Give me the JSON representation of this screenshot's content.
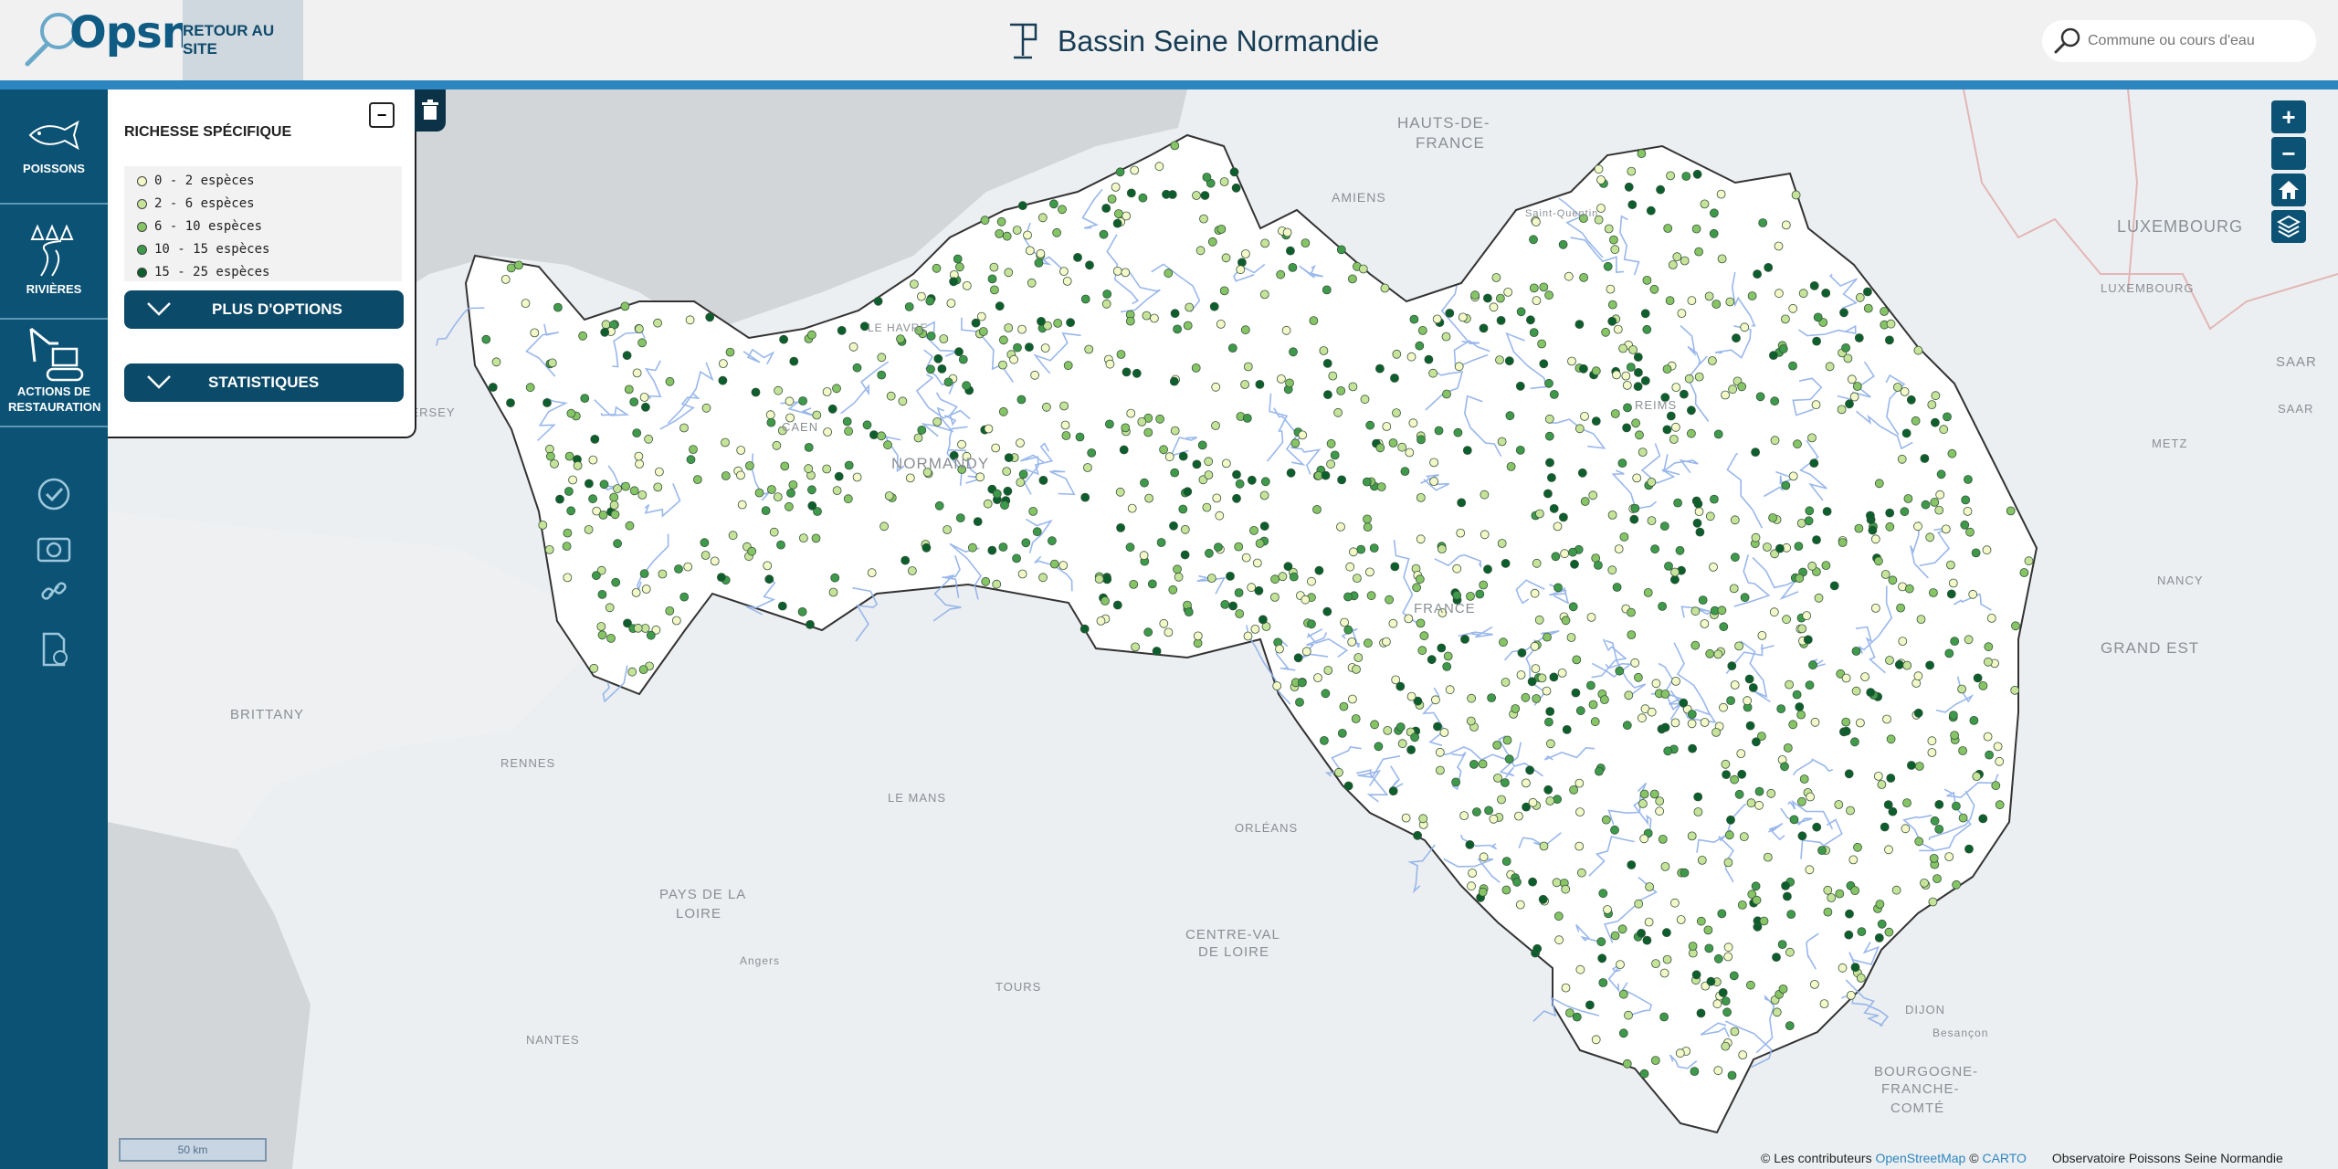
{
  "header": {
    "logo_text": "Opsn",
    "back_label": "RETOUR AU SITE",
    "title": "Bassin Seine Normandie",
    "search_placeholder": "Commune ou cours d'eau"
  },
  "sidebar": {
    "items": [
      {
        "label": "POISSONS"
      },
      {
        "label": "RIVIÈRES"
      },
      {
        "label": "ACTIONS DE RESTAURATION"
      }
    ]
  },
  "legend": {
    "title": "RICHESSE SPÉCIFIQUE",
    "classes": [
      {
        "label": "0 - 2 espèces",
        "color": "#f4f7c8"
      },
      {
        "label": "2 - 6 espèces",
        "color": "#c7e39a"
      },
      {
        "label": "6 - 10 espèces",
        "color": "#87c466"
      },
      {
        "label": "10 - 15 espèces",
        "color": "#3e9a4a"
      },
      {
        "label": "15 - 25 espèces",
        "color": "#0c5e2c"
      }
    ],
    "more_options_label": "PLUS D'OPTIONS",
    "statistics_label": "STATISTIQUES"
  },
  "map": {
    "labels": [
      {
        "text": "HAUTS-DE-"
      },
      {
        "text": "FRANCE"
      },
      {
        "text": "AMIENS"
      },
      {
        "text": "Saint-Quentin"
      },
      {
        "text": "LUXEMBOURG"
      },
      {
        "text": "LUXEMBOURG"
      },
      {
        "text": "SAAR"
      },
      {
        "text": "SAAR"
      },
      {
        "text": "METZ"
      },
      {
        "text": "NANCY"
      },
      {
        "text": "GRAND EST"
      },
      {
        "text": "LE HAVRE"
      },
      {
        "text": "CAEN"
      },
      {
        "text": "NORMANDY"
      },
      {
        "text": "JERSEY"
      },
      {
        "text": "BRITTANY"
      },
      {
        "text": "RENNES"
      },
      {
        "text": "LE MANS"
      },
      {
        "text": "ORLÉANS"
      },
      {
        "text": "PAYS DE LA"
      },
      {
        "text": "LOIRE"
      },
      {
        "text": "Angers"
      },
      {
        "text": "TOURS"
      },
      {
        "text": "CENTRE-VAL"
      },
      {
        "text": "DE LOIRE"
      },
      {
        "text": "NANTES"
      },
      {
        "text": "DIJON"
      },
      {
        "text": "Besançon"
      },
      {
        "text": "BOURGOGNE-"
      },
      {
        "text": "FRANCHE-"
      },
      {
        "text": "COMTÉ"
      },
      {
        "text": "REIMS"
      },
      {
        "text": "FRANCE"
      }
    ],
    "scale_label": "50 km",
    "attribution": {
      "prefix": "© Les contributeurs",
      "osm": "OpenStreetMap",
      "sep": "©",
      "carto": "CARTO",
      "owner": "Observatoire Poissons Seine Normandie"
    },
    "controls": {
      "zoom_in": "+",
      "zoom_out": "−"
    }
  }
}
